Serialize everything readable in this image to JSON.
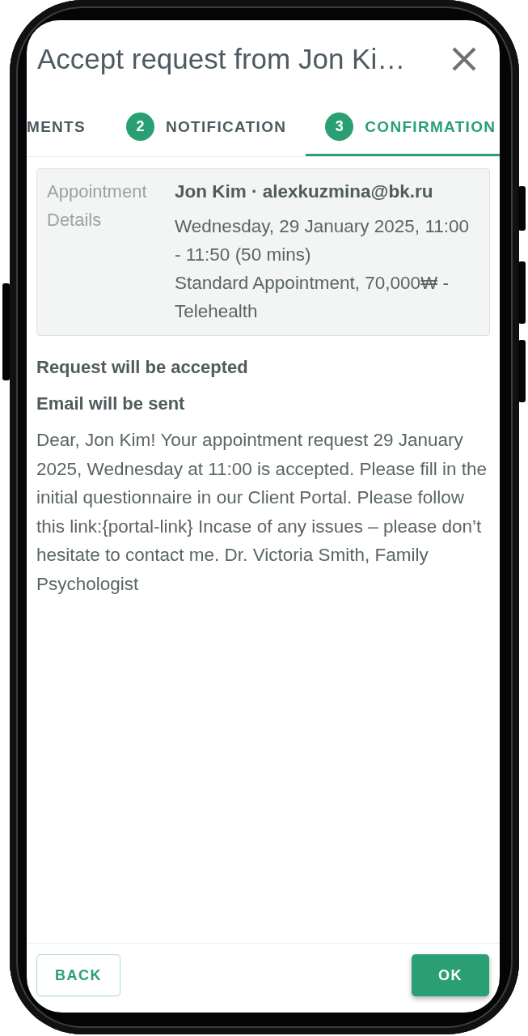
{
  "dialog": {
    "title": "Accept request from Jon Ki…"
  },
  "tabs": [
    {
      "label": "MENTS",
      "selected": false
    },
    {
      "step": "2",
      "label": "NOTIFICATION",
      "selected": false
    },
    {
      "step": "3",
      "label": "CONFIRMATION",
      "selected": true
    }
  ],
  "details": {
    "label": "Appointment Details",
    "client": "Jon Kim · alexkuzmina@bk.ru",
    "lines": [
      "Wednesday, 29 January 2025, 11:00 - 11:50 (50 mins)",
      "Standard Appointment, 70,000₩ - Telehealth"
    ]
  },
  "outcomes": [
    "Request will be accepted",
    "Email will be sent"
  ],
  "email_body": "Dear, Jon Kim! Your appointment request 29 January 2025, Wednesday at 11:00 is accepted. Please fill in the initial questionnaire in our Client Portal. Please follow this link:{portal-link} Incase of any issues – please don’t hesitate to contact me. Dr. Victoria Smith, Family Psychologist",
  "buttons": [
    {
      "kind": "outlined",
      "label": "BACK"
    },
    {
      "kind": "filled",
      "label": "OK"
    }
  ]
}
